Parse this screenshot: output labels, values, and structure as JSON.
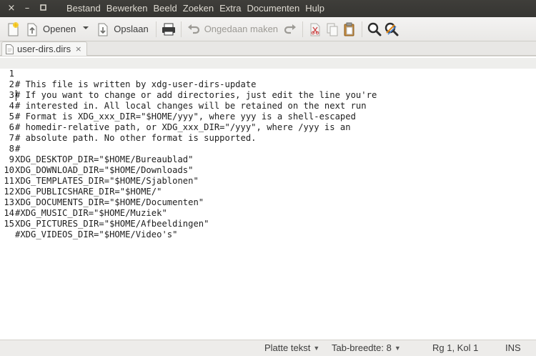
{
  "window": {
    "controls": [
      "×",
      "–",
      "□"
    ],
    "control_names": [
      "close",
      "minimize",
      "maximize"
    ]
  },
  "menubar": {
    "items": [
      "Bestand",
      "Bewerken",
      "Beeld",
      "Zoeken",
      "Extra",
      "Documenten",
      "Hulp"
    ]
  },
  "toolbar": {
    "new_icon": "new-document-icon",
    "open_icon": "open-folder-icon",
    "open_label": "Openen",
    "open_dropdown_icon": "chevron-down-icon",
    "save_icon": "save-icon",
    "save_label": "Opslaan",
    "print_icon": "printer-icon",
    "undo_icon": "undo-icon",
    "undo_label": "Ongedaan maken",
    "redo_icon": "redo-icon",
    "cut_icon": "cut-icon",
    "copy_icon": "copy-icon",
    "paste_icon": "paste-icon",
    "search_icon": "search-icon",
    "replace_icon": "search-replace-icon"
  },
  "tabs": [
    {
      "label": "user-dirs.dirs",
      "close": "×"
    }
  ],
  "editor": {
    "current_line": 1,
    "lines": [
      {
        "n": "1",
        "text": "# This file is written by xdg-user-dirs-update"
      },
      {
        "n": "2",
        "text": "# If you want to change or add directories, just edit the line you're"
      },
      {
        "n": "3",
        "text": "# interested in. All local changes will be retained on the next run"
      },
      {
        "n": "4",
        "text": "# Format is XDG_xxx_DIR=\"$HOME/yyy\", where yyy is a shell-escaped"
      },
      {
        "n": "5",
        "text": "# homedir-relative path, or XDG_xxx_DIR=\"/yyy\", where /yyy is an"
      },
      {
        "n": "6",
        "text": "# absolute path. No other format is supported."
      },
      {
        "n": "7",
        "text": "#"
      },
      {
        "n": "8",
        "text": "XDG_DESKTOP_DIR=\"$HOME/Bureaublad\""
      },
      {
        "n": "9",
        "text": "XDG_DOWNLOAD_DIR=\"$HOME/Downloads\""
      },
      {
        "n": "10",
        "text": "XDG_TEMPLATES_DIR=\"$HOME/Sjablonen\""
      },
      {
        "n": "11",
        "text": "XDG_PUBLICSHARE_DIR=\"$HOME/\""
      },
      {
        "n": "12",
        "text": "XDG_DOCUMENTS_DIR=\"$HOME/Documenten\""
      },
      {
        "n": "13",
        "text": "#XDG_MUSIC_DIR=\"$HOME/Muziek\""
      },
      {
        "n": "14",
        "text": "XDG_PICTURES_DIR=\"$HOME/Afbeeldingen\""
      },
      {
        "n": "15",
        "text": "#XDG_VIDEOS_DIR=\"$HOME/Video's\""
      }
    ]
  },
  "statusbar": {
    "language": "Platte tekst",
    "tab_width": "Tab-breedte: 8",
    "position": "Rg 1, Kol 1",
    "mode": "INS"
  }
}
